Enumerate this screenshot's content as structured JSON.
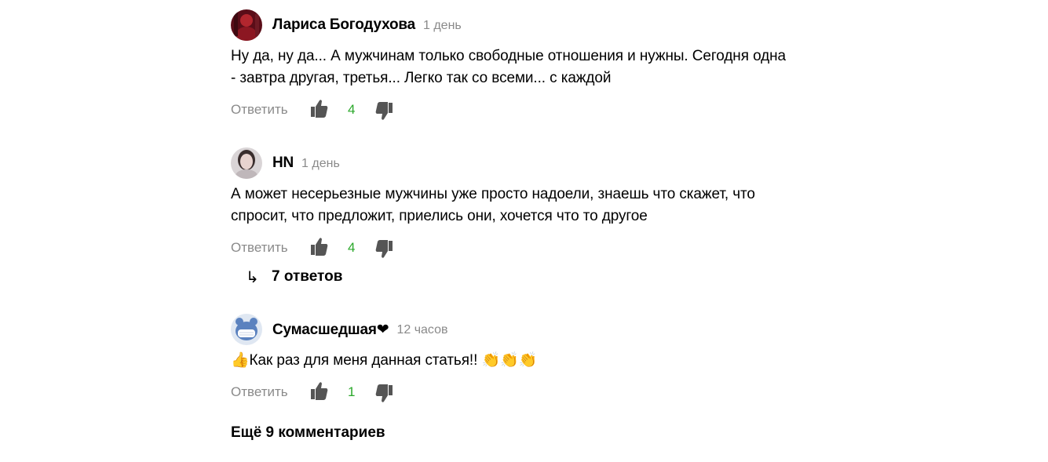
{
  "comments": [
    {
      "author": "Лариса Богодухова",
      "time": "1 день",
      "text_lines": [
        "Ну да, ну да... А мужчинам только свободные отношения и нужны. Сегодня одна",
        "- завтра другая, третья... Легко так со всеми... с каждой"
      ],
      "reply_label": "Ответить",
      "likes": "4"
    },
    {
      "author": "HN",
      "time": "1 день",
      "text_lines": [
        "А может несерьезные мужчины уже просто надоели, знаешь что скажет, что",
        "спросит, что предложит, приелись они, хочется что то другое"
      ],
      "reply_label": "Ответить",
      "likes": "4",
      "replies_label": "7 ответов"
    },
    {
      "author": "Сумасшедшая❤",
      "time": "12 часов",
      "text_lines": [
        "👍Как раз для меня данная статья!! 👏👏👏"
      ],
      "reply_label": "Ответить",
      "likes": "1"
    }
  ],
  "more_comments_label": "Ещё 9 комментариев",
  "colors": {
    "like_count": "#2ba82b",
    "muted_text": "#8a8a8a",
    "icon_gray": "#555555"
  }
}
